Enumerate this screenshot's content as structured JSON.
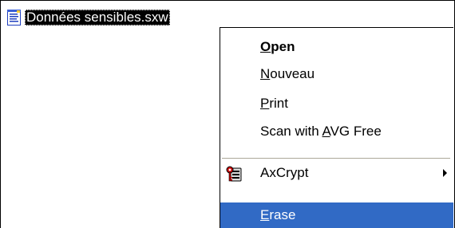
{
  "file": {
    "name": "Données sensibles.sxw",
    "icon": "writer-document-icon"
  },
  "context_menu": {
    "items": [
      {
        "label_pre": "",
        "label_ul": "O",
        "label_post": "pen",
        "default": true,
        "icon": ""
      },
      {
        "label_pre": "",
        "label_ul": "N",
        "label_post": "ouveau",
        "default": false,
        "icon": ""
      },
      {
        "label_pre": "",
        "label_ul": "P",
        "label_post": "rint",
        "default": false,
        "icon": ""
      },
      {
        "label_pre": "Scan with ",
        "label_ul": "A",
        "label_post": "VG Free",
        "default": false,
        "icon": ""
      },
      {
        "label_pre": "AxCrypt",
        "label_ul": "",
        "label_post": "",
        "default": false,
        "icon": "axcrypt-icon",
        "has_submenu": true
      },
      {
        "label_pre": "",
        "label_ul": "E",
        "label_post": "rase",
        "default": false,
        "icon": "",
        "highlighted": true
      }
    ]
  },
  "colors": {
    "selection_bg": "#000000",
    "menu_highlight": "#316ac5",
    "separator": "#aca899"
  }
}
